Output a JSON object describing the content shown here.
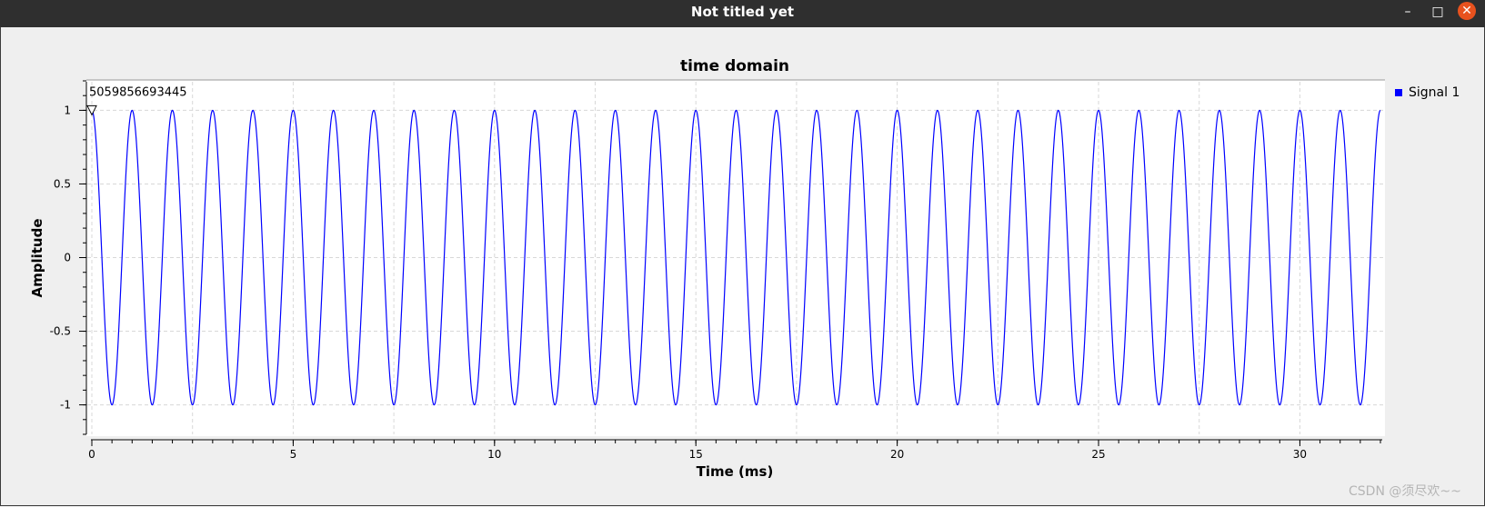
{
  "window": {
    "title": "Not titled yet",
    "minimize_glyph": "–",
    "maximize_glyph": "□",
    "close_glyph": "✕"
  },
  "chart_data": {
    "type": "line",
    "title": "time domain",
    "xlabel": "Time (ms)",
    "ylabel": "Amplitude",
    "xlim": [
      0,
      32
    ],
    "ylim": [
      -1.2,
      1.2
    ],
    "x_ticks": [
      0,
      5,
      10,
      15,
      20,
      25,
      30
    ],
    "x_tick_labels": [
      "0",
      "5",
      "10",
      "15",
      "20",
      "25",
      "30"
    ],
    "y_ticks": [
      1,
      0.5,
      0,
      -0.5,
      -1
    ],
    "y_tick_labels": [
      "1",
      "0.5",
      "0",
      "-0.5",
      "-1"
    ],
    "grid": true,
    "legend_position": "right",
    "series": [
      {
        "name": "Signal 1",
        "color": "#0000ff",
        "waveform": "cosine",
        "amplitude": 1,
        "frequency_khz": 1,
        "x_start": 0,
        "x_end": 32
      }
    ],
    "marker": {
      "label": "5059856693445",
      "x": 0,
      "y": 1
    }
  },
  "watermark": "CSDN @须尽欢~~"
}
